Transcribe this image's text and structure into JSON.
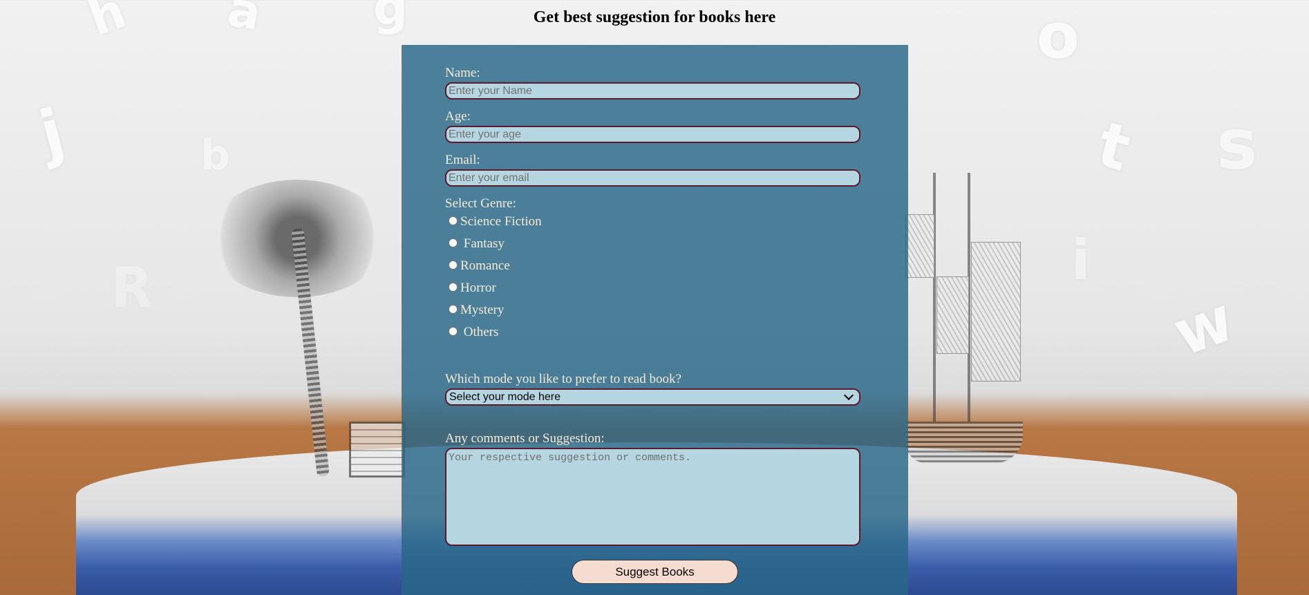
{
  "page": {
    "heading": "Get best suggestion for books here"
  },
  "form": {
    "name": {
      "label": "Name:",
      "placeholder": "Enter your Name"
    },
    "age": {
      "label": "Age:",
      "placeholder": "Enter your age"
    },
    "email": {
      "label": "Email:",
      "placeholder": "Enter your email"
    },
    "genre": {
      "label": "Select Genre:",
      "options": [
        "Science Fiction",
        " Fantasy",
        "Romance",
        "Horror",
        "Mystery",
        " Others"
      ]
    },
    "mode": {
      "label": "Which mode you like to prefer to read book?",
      "selected": "Select your mode here"
    },
    "comments": {
      "label": "Any comments or Suggestion:",
      "placeholder": "Your respective suggestion or comments."
    },
    "submit_label": "Suggest Books"
  },
  "colors": {
    "panel": "#286787",
    "input_bg": "#b5d6e1",
    "input_border": "#5a1a2e",
    "button_bg": "#f6dbd1",
    "label_text": "#f4ecd8"
  }
}
